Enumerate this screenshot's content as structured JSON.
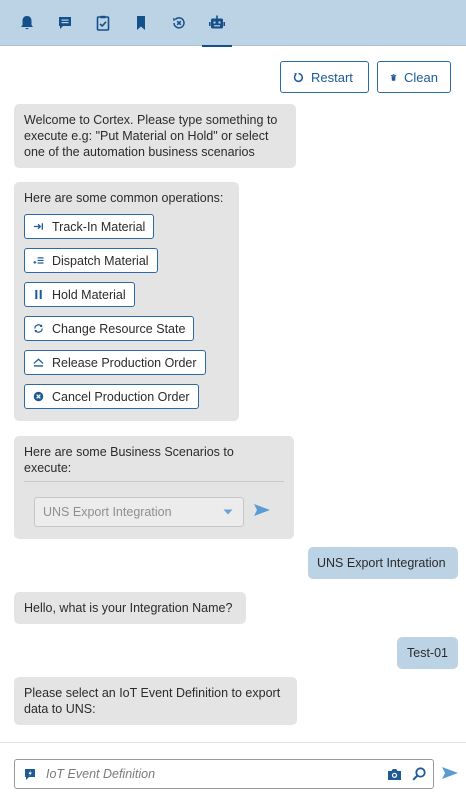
{
  "tabs": [
    {
      "name": "notifications",
      "icon": "bell-icon"
    },
    {
      "name": "chat",
      "icon": "message-icon"
    },
    {
      "name": "tasks",
      "icon": "clipboard-check-icon"
    },
    {
      "name": "bookmarks",
      "icon": "bookmark-icon"
    },
    {
      "name": "history",
      "icon": "history-close-icon"
    },
    {
      "name": "assistant",
      "icon": "robot-icon",
      "active": true
    }
  ],
  "toolbar": {
    "restart_label": "Restart",
    "clean_label": "Clean"
  },
  "messages": {
    "welcome": "Welcome to Cortex. Please type something to execute e.g: \"Put Material on Hold\" or select one of the automation business scenarios",
    "operations_title": "Here are some common operations:",
    "operations": [
      {
        "label": "Track-In Material",
        "icon": "track-in-icon"
      },
      {
        "label": "Dispatch Material",
        "icon": "dispatch-icon"
      },
      {
        "label": "Hold Material",
        "icon": "pause-icon"
      },
      {
        "label": "Change Resource State",
        "icon": "refresh-icon"
      },
      {
        "label": "Release Production Order",
        "icon": "eject-icon"
      },
      {
        "label": "Cancel Production Order",
        "icon": "cancel-circle-icon"
      }
    ],
    "scenarios_title": "Here are some Business Scenarios to execute:",
    "scenario_selected": "UNS Export Integration",
    "user_scenario": "UNS Export Integration",
    "ask_integration_name": "Hello, what is your Integration Name?",
    "user_integration_name": "Test-01",
    "ask_iot_event": "Please select an IoT Event Definition to export data to UNS:"
  },
  "input": {
    "placeholder": "IoT Event Definition",
    "value": ""
  },
  "colors": {
    "tabbar_bg": "#bcd3e6",
    "icon_blue": "#16508a",
    "accent": "#2b6aa6",
    "bot_bubble": "#e4e4e4",
    "user_bubble": "#bcd3e6",
    "send_arrow": "#5a9bd4"
  }
}
